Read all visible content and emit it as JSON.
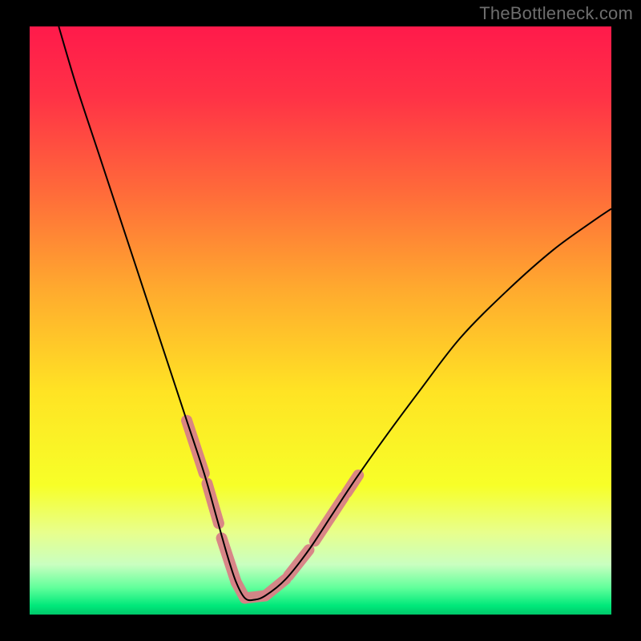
{
  "watermark": "TheBottleneck.com",
  "chart_data": {
    "type": "line",
    "title": "",
    "xlabel": "",
    "ylabel": "",
    "xlim": [
      0,
      100
    ],
    "ylim": [
      0,
      100
    ],
    "gradient_stops": [
      {
        "offset": 0.0,
        "color": "#ff1a4b"
      },
      {
        "offset": 0.12,
        "color": "#ff3246"
      },
      {
        "offset": 0.28,
        "color": "#ff6a3a"
      },
      {
        "offset": 0.45,
        "color": "#ffab2e"
      },
      {
        "offset": 0.62,
        "color": "#ffe324"
      },
      {
        "offset": 0.78,
        "color": "#f7ff28"
      },
      {
        "offset": 0.86,
        "color": "#e8ff8c"
      },
      {
        "offset": 0.915,
        "color": "#c9ffc0"
      },
      {
        "offset": 0.955,
        "color": "#5fff9a"
      },
      {
        "offset": 0.985,
        "color": "#00e87a"
      },
      {
        "offset": 1.0,
        "color": "#00c86a"
      }
    ],
    "series": [
      {
        "name": "bottleneck-curve",
        "x": [
          5,
          8,
          12,
          16,
          20,
          24,
          27,
          30,
          32,
          34,
          35.5,
          37,
          38.5,
          40.5,
          44,
          48,
          52,
          56,
          61,
          67,
          74,
          82,
          90,
          97,
          100
        ],
        "y": [
          100,
          90,
          78,
          66,
          54,
          42,
          33,
          24,
          17,
          10,
          5.5,
          2.8,
          2.5,
          3.2,
          6,
          11,
          17,
          23,
          30,
          38,
          47,
          55,
          62,
          67,
          69
        ]
      }
    ],
    "highlight_segments": [
      {
        "x": [
          27.0,
          30.0
        ],
        "y": [
          33.0,
          24.0
        ]
      },
      {
        "x": [
          30.5,
          32.5
        ],
        "y": [
          22.3,
          15.5
        ]
      },
      {
        "x": [
          33.0,
          35.5
        ],
        "y": [
          13.0,
          5.5
        ]
      },
      {
        "x": [
          35.5,
          37.0
        ],
        "y": [
          5.5,
          2.8
        ]
      },
      {
        "x": [
          37.0,
          40.5
        ],
        "y": [
          2.8,
          3.2
        ]
      },
      {
        "x": [
          40.5,
          44.0
        ],
        "y": [
          3.2,
          6.0
        ]
      },
      {
        "x": [
          44.5,
          48.0
        ],
        "y": [
          6.6,
          11.0
        ]
      },
      {
        "x": [
          49.0,
          54.0
        ],
        "y": [
          12.5,
          20.0
        ]
      },
      {
        "x": [
          54.5,
          56.5
        ],
        "y": [
          20.7,
          23.7
        ]
      }
    ],
    "highlight_color": "#d98086",
    "curve_color": "#000000"
  }
}
